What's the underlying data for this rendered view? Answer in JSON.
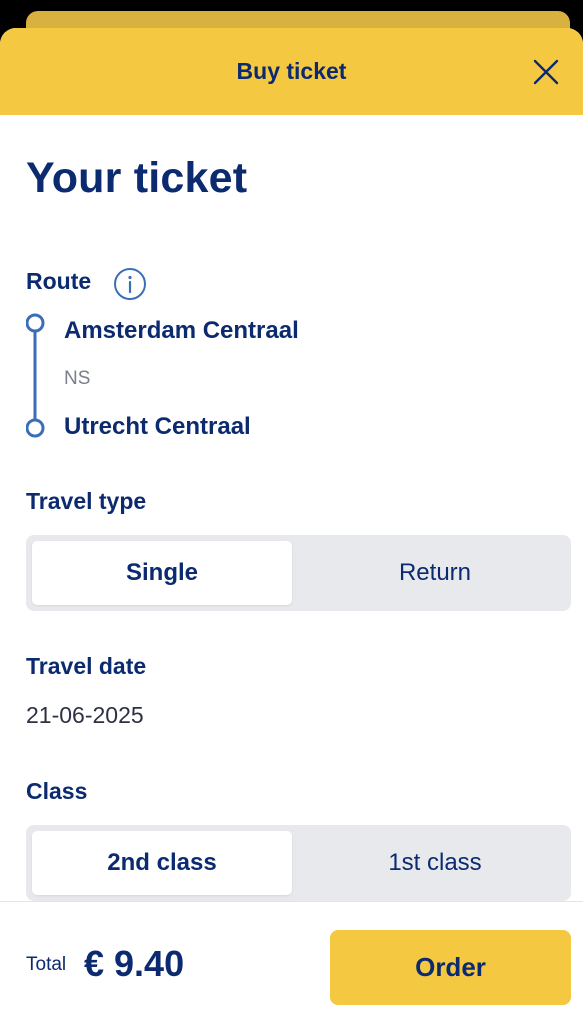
{
  "header": {
    "title": "Buy ticket"
  },
  "page": {
    "title": "Your ticket"
  },
  "route": {
    "label": "Route",
    "from": "Amsterdam Centraal",
    "operator": "NS",
    "to": "Utrecht Centraal"
  },
  "travel_type": {
    "label": "Travel type",
    "options": [
      "Single",
      "Return"
    ],
    "selected": "Single"
  },
  "travel_date": {
    "label": "Travel date",
    "value": "21-06-2025"
  },
  "class": {
    "label": "Class",
    "options": [
      "2nd class",
      "1st class"
    ],
    "selected": "2nd class"
  },
  "footer": {
    "total_label": "Total",
    "total_value": "€ 9.40",
    "order_label": "Order"
  },
  "colors": {
    "brand_yellow": "#f5c842",
    "brand_blue": "#0b2a6f",
    "route_line": "#3a6fb8",
    "segment_bg": "#e8e9ed"
  },
  "icons": [
    "close-icon",
    "info-icon"
  ]
}
